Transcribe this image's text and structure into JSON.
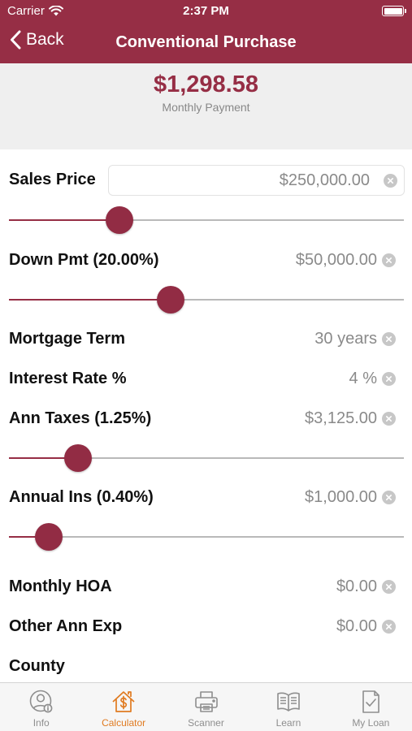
{
  "status": {
    "carrier": "Carrier",
    "time": "2:37 PM"
  },
  "nav": {
    "back_label": "Back",
    "title": "Conventional Purchase"
  },
  "summary": {
    "amount": "$1,298.58",
    "label": "Monthly Payment"
  },
  "fields": {
    "sales_price": {
      "label": "Sales Price",
      "value": "$250,000.00",
      "slider": 0.28
    },
    "down_pmt": {
      "label": "Down Pmt (20.00%)",
      "value": "$50,000.00",
      "slider": 0.41
    },
    "mortgage_term": {
      "label": "Mortgage Term",
      "value": "30 years"
    },
    "interest_rate": {
      "label": "Interest Rate %",
      "value": "4 %"
    },
    "ann_taxes": {
      "label": "Ann Taxes (1.25%)",
      "value": "$3,125.00",
      "slider": 0.175
    },
    "annual_ins": {
      "label": "Annual Ins (0.40%)",
      "value": "$1,000.00",
      "slider": 0.1
    },
    "monthly_hoa": {
      "label": "Monthly HOA",
      "value": "$0.00"
    },
    "other_ann_exp": {
      "label": "Other Ann Exp",
      "value": "$0.00"
    },
    "county": {
      "label": "County"
    }
  },
  "tabs": [
    {
      "label": "Info",
      "icon": "person-info-icon",
      "active": false
    },
    {
      "label": "Calculator",
      "icon": "house-dollar-icon",
      "active": true
    },
    {
      "label": "Scanner",
      "icon": "printer-icon",
      "active": false
    },
    {
      "label": "Learn",
      "icon": "open-book-icon",
      "active": false
    },
    {
      "label": "My Loan",
      "icon": "document-check-icon",
      "active": false
    }
  ],
  "colors": {
    "brand": "#962e45",
    "active_tab": "#e07b21",
    "muted_text": "#8a8a8a"
  }
}
